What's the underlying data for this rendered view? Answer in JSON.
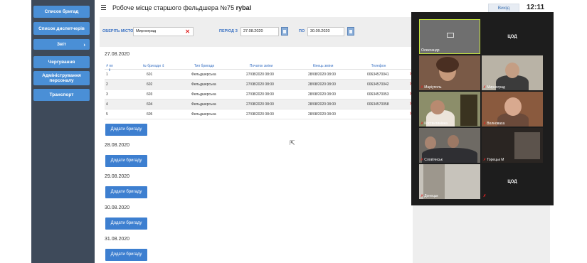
{
  "sidebar": {
    "items": [
      {
        "label": "Список бригад"
      },
      {
        "label": "Список диспетчерів"
      },
      {
        "label": "Звіт"
      },
      {
        "label": "Чергування"
      },
      {
        "label": "Адміністрування персоналу"
      },
      {
        "label": "Транспорт"
      }
    ]
  },
  "header": {
    "title": "Робоче місце старшого фельдшера №75",
    "user": "rybal",
    "exit_label": "Вихід",
    "clock": "12:11"
  },
  "filter": {
    "city_label": "ОБЕРІТЬ МІСТО",
    "city_value": "Мирноград",
    "period_from_label": "ПЕРІОД З",
    "period_from": "27.08.2020",
    "period_to_label": "ПО",
    "period_to": "30.09.2020"
  },
  "table": {
    "headers": [
      "# пп ⇕",
      "№ бригади ⇕",
      "Тип бригади",
      "Початок зміни",
      "Кінець зміни",
      "Телефон"
    ],
    "rows": [
      [
        "1",
        "601",
        "Фельдшерська",
        "27/08/2020 08:00",
        "28/08/2020 08:00",
        "00634570041"
      ],
      [
        "2",
        "602",
        "Фельдшерська",
        "27/08/2020 08:00",
        "28/08/2020 08:00",
        "00634570042"
      ],
      [
        "3",
        "603",
        "Фельдшерська",
        "27/08/2020 08:00",
        "28/08/2020 08:00",
        "00634570053"
      ],
      [
        "4",
        "604",
        "Фельдшерська",
        "27/08/2020 08:00",
        "28/08/2020 08:00",
        "00634570058"
      ],
      [
        "5",
        "605",
        "Фельдшерська",
        "27/08/2020 08:00",
        "28/08/2020 08:00",
        ""
      ]
    ]
  },
  "days": [
    {
      "date": "27.08.2020",
      "add_label": "Додати бригаду"
    },
    {
      "date": "28.08.2020",
      "add_label": "Додати бригаду"
    },
    {
      "date": "29.08.2020",
      "add_label": "Додати бригаду"
    },
    {
      "date": "30.08.2020",
      "add_label": "Додати бригаду"
    },
    {
      "date": "31.08.2020",
      "add_label": "Додати бригаду"
    }
  ],
  "video": {
    "tiles": [
      {
        "name": "Олександр",
        "muted": false
      },
      {
        "name": "ЦОД",
        "muted": false
      },
      {
        "name": "Маріуполь",
        "muted": true
      },
      {
        "name": "Мирноград",
        "muted": true
      },
      {
        "name": "Костянтинівка",
        "muted": true
      },
      {
        "name": "Волноваха",
        "muted": true
      },
      {
        "name": "Слов'янськ",
        "muted": true
      },
      {
        "name": "Торецьк М",
        "muted": true
      },
      {
        "name": "Донецьк",
        "muted": true
      },
      {
        "name": "ЦОД",
        "muted": true
      }
    ]
  },
  "colors": {
    "sidebar_bg": "#3e4a5a",
    "accent": "#4a8fd6",
    "delete": "#e02424"
  }
}
